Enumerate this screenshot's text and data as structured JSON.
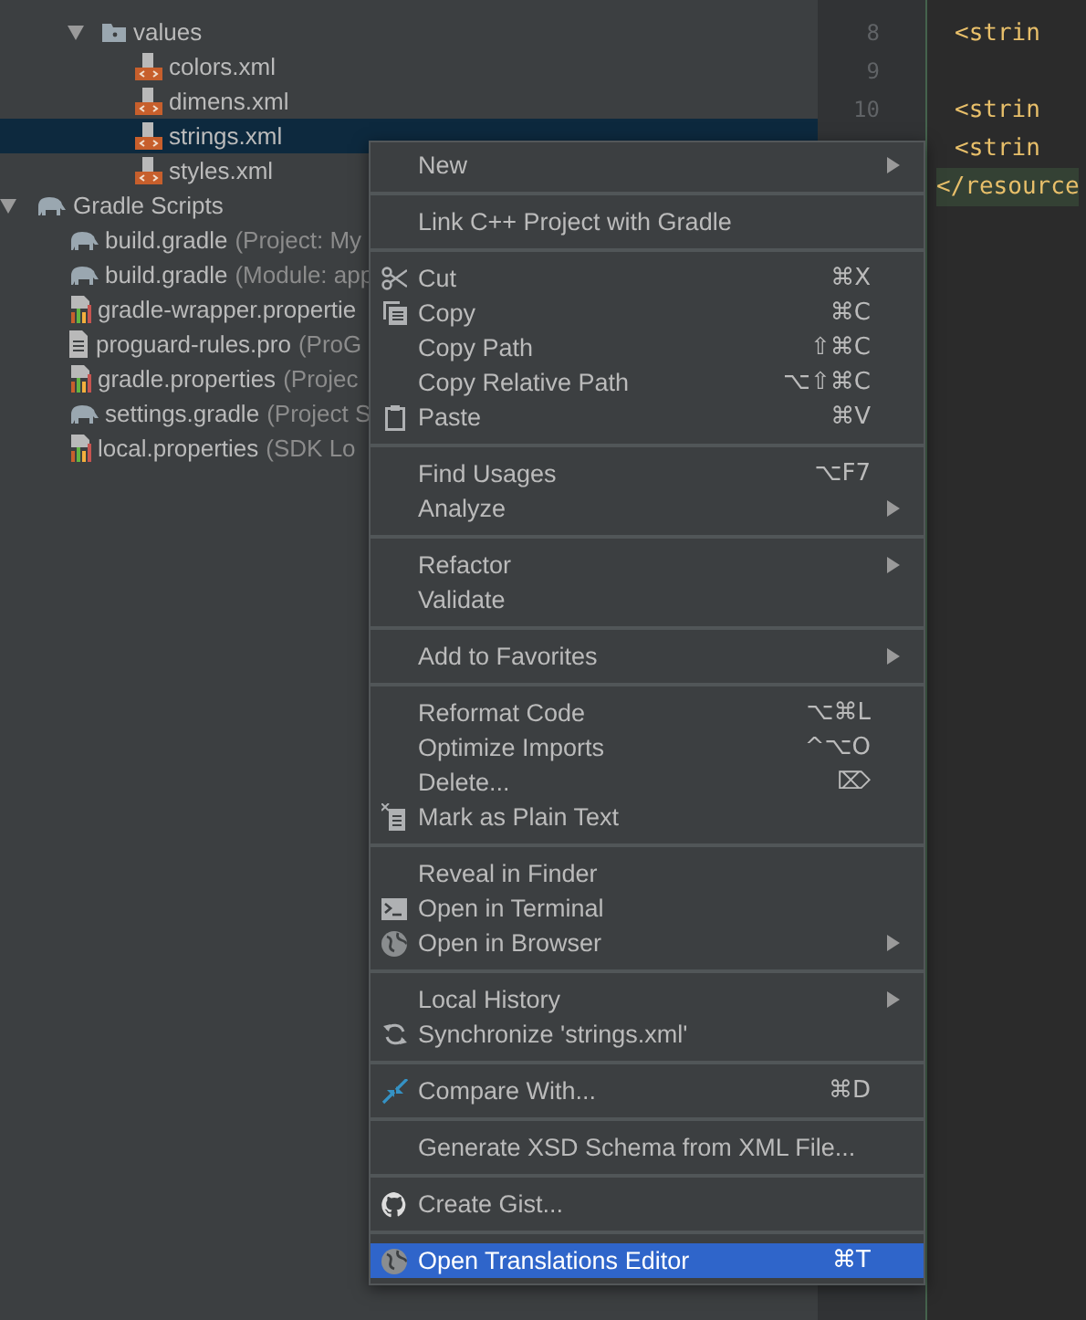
{
  "project_tree": {
    "res_children": [
      {
        "label": "values",
        "kind": "folder",
        "expanded": true,
        "children": [
          {
            "label": "colors.xml",
            "kind": "xml",
            "selected": false
          },
          {
            "label": "dimens.xml",
            "kind": "xml",
            "selected": false
          },
          {
            "label": "strings.xml",
            "kind": "xml",
            "selected": true
          },
          {
            "label": "styles.xml",
            "kind": "xml",
            "selected": false
          }
        ]
      }
    ],
    "items": [
      {
        "label": "Gradle Scripts",
        "kind": "gradle",
        "expanded": true,
        "children": [
          {
            "label": "build.gradle",
            "detail": "(Project: My",
            "kind": "gradle",
            "selected": false
          },
          {
            "label": "build.gradle",
            "detail": "(Module: app",
            "kind": "gradle",
            "selected": false
          },
          {
            "label": "gradle-wrapper.propertie",
            "kind": "properties",
            "selected": false
          },
          {
            "label": "proguard-rules.pro",
            "detail": "(ProG",
            "kind": "text",
            "selected": false
          },
          {
            "label": "gradle.properties",
            "detail": "(Projec",
            "kind": "properties",
            "selected": false
          },
          {
            "label": "settings.gradle",
            "detail": "(Project S",
            "kind": "gradle",
            "selected": false
          },
          {
            "label": "local.properties",
            "detail": "(SDK Lo",
            "kind": "properties",
            "selected": false
          }
        ]
      }
    ]
  },
  "editor": {
    "lines": [
      {
        "number": "8",
        "code": "<strin",
        "highlighted": false
      },
      {
        "number": "9",
        "highlighted": false
      },
      {
        "number": "10",
        "code": "<strin",
        "highlighted": false
      },
      {
        "code": "<strin",
        "highlighted": false
      },
      {
        "code": "</resource",
        "highlighted": true
      }
    ]
  },
  "context_menu": {
    "groups": [
      [
        {
          "label": "New",
          "kind": "plain",
          "submenu": true,
          "selected": false
        }
      ],
      [
        {
          "label": "Link C++ Project with Gradle",
          "kind": "plain",
          "submenu": false,
          "selected": false
        }
      ],
      [
        {
          "label": "Cut",
          "shortcut": "⌘X",
          "kind": "cut",
          "submenu": false,
          "selected": false
        },
        {
          "label": "Copy",
          "shortcut": "⌘C",
          "kind": "copy",
          "submenu": false,
          "selected": false
        },
        {
          "label": "Copy Path",
          "shortcut": "⇧⌘C",
          "kind": "plain",
          "submenu": false,
          "selected": false
        },
        {
          "label": "Copy Relative Path",
          "shortcut": "⌥⇧⌘C",
          "kind": "plain",
          "submenu": false,
          "selected": false
        },
        {
          "label": "Paste",
          "shortcut": "⌘V",
          "kind": "paste",
          "submenu": false,
          "selected": false
        }
      ],
      [
        {
          "label": "Find Usages",
          "shortcut": "⌥F7",
          "kind": "plain",
          "submenu": false,
          "selected": false
        },
        {
          "label": "Analyze",
          "kind": "plain",
          "submenu": true,
          "selected": false
        }
      ],
      [
        {
          "label": "Refactor",
          "kind": "plain",
          "submenu": true,
          "selected": false
        },
        {
          "label": "Validate",
          "kind": "plain",
          "submenu": false,
          "selected": false
        }
      ],
      [
        {
          "label": "Add to Favorites",
          "kind": "plain",
          "submenu": true,
          "selected": false
        }
      ],
      [
        {
          "label": "Reformat Code",
          "shortcut": "⌥⌘L",
          "kind": "plain",
          "submenu": false,
          "selected": false
        },
        {
          "label": "Optimize Imports",
          "shortcut": "^⌥O",
          "kind": "plain",
          "submenu": false,
          "selected": false
        },
        {
          "label": "Delete...",
          "shortcut": "⌦",
          "kind": "plain",
          "submenu": false,
          "selected": false
        },
        {
          "label": "Mark as Plain Text",
          "kind": "mark",
          "submenu": false,
          "selected": false
        }
      ],
      [
        {
          "label": "Reveal in Finder",
          "kind": "plain",
          "submenu": false,
          "selected": false
        },
        {
          "label": "Open in Terminal",
          "kind": "terminal",
          "submenu": false,
          "selected": false
        },
        {
          "label": "Open in Browser",
          "kind": "globe",
          "submenu": true,
          "selected": false
        }
      ],
      [
        {
          "label": "Local History",
          "kind": "plain",
          "submenu": true,
          "selected": false
        },
        {
          "label": "Synchronize 'strings.xml'",
          "kind": "sync",
          "submenu": false,
          "selected": false
        }
      ],
      [
        {
          "label": "Compare With...",
          "shortcut": "⌘D",
          "kind": "compare",
          "submenu": false,
          "selected": false
        }
      ],
      [
        {
          "label": "Generate XSD Schema from XML File...",
          "kind": "plain",
          "submenu": false,
          "selected": false
        }
      ],
      [
        {
          "label": "Create Gist...",
          "kind": "cat",
          "submenu": false,
          "selected": false
        }
      ],
      [
        {
          "label": "Open Translations Editor",
          "shortcut": "⌘T",
          "kind": "globe",
          "submenu": false,
          "selected": true
        }
      ]
    ]
  }
}
